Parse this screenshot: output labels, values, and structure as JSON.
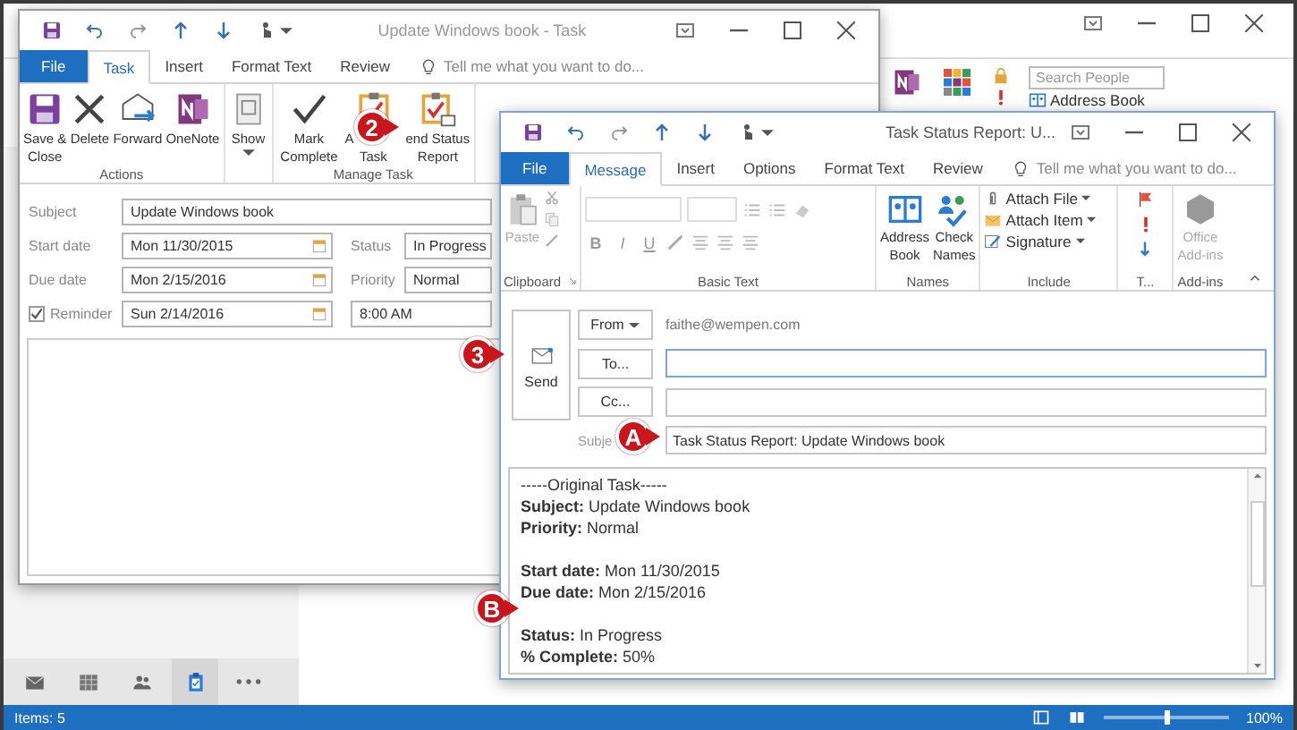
{
  "main_window": {
    "search_people": {
      "placeholder": "Search People"
    },
    "address_book": "Address Book",
    "nav": [
      {
        "kind": "mail",
        "selected": false
      },
      {
        "kind": "calendar",
        "selected": false
      },
      {
        "kind": "people",
        "selected": false
      },
      {
        "kind": "tasks",
        "selected": true
      },
      {
        "kind": "more",
        "selected": false
      }
    ],
    "status_bar": {
      "items": "Items: 5",
      "zoom": "100%",
      "zoom_slider": {
        "level": 0.5
      }
    }
  },
  "task_window": {
    "title": "Update Windows book - Task",
    "tell_me": "Tell me what you want to do...",
    "tabs": [
      {
        "label": "File",
        "kind": "file",
        "selected": false
      },
      {
        "label": "Task",
        "kind": "tab",
        "selected": true
      },
      {
        "label": "Insert",
        "kind": "tab",
        "selected": false
      },
      {
        "label": "Format Text",
        "kind": "tab",
        "selected": false
      },
      {
        "label": "Review",
        "kind": "tab",
        "selected": false
      }
    ],
    "ribbon_groups": [
      {
        "label": "Actions",
        "buttons": [
          {
            "kind": "save",
            "lines": [
              "Save &",
              "Close"
            ]
          },
          {
            "kind": "delete",
            "lines": [
              "Delete"
            ]
          },
          {
            "kind": "forward",
            "lines": [
              "Forward"
            ]
          },
          {
            "kind": "onenote",
            "lines": [
              "OneNote"
            ]
          }
        ]
      },
      {
        "buttons": [
          {
            "kind": "show",
            "lines": [
              "Show"
            ],
            "dropdown": true
          }
        ]
      },
      {
        "label": "Manage Task",
        "buttons": [
          {
            "kind": "check",
            "lines": [
              "Mark",
              "Complete"
            ]
          },
          {
            "kind": "assign",
            "lines": [
              "A",
              "Task"
            ]
          },
          {
            "kind": "report",
            "lines": [
              "end Status",
              "Report"
            ]
          }
        ]
      }
    ],
    "form": {
      "subject": {
        "label": "Subject",
        "value": "Update Windows book"
      },
      "start_date": {
        "label": "Start date",
        "value": "Mon 11/30/2015"
      },
      "status": {
        "label": "Status",
        "value": "In Progress"
      },
      "due_date": {
        "label": "Due date",
        "value": "Mon 2/15/2016"
      },
      "priority": {
        "label": "Priority",
        "value": "Normal"
      },
      "reminder": {
        "label": "Reminder",
        "checked": true,
        "date": "Sun 2/14/2016",
        "time": "8:00 AM"
      }
    }
  },
  "message_window": {
    "title": "Task Status Report: U...",
    "tell_me": "Tell me what you want to do...",
    "tabs": [
      {
        "label": "File",
        "kind": "file",
        "selected": false
      },
      {
        "label": "Message",
        "kind": "tab",
        "selected": true
      },
      {
        "label": "Insert",
        "kind": "tab",
        "selected": false
      },
      {
        "label": "Options",
        "kind": "tab",
        "selected": false
      },
      {
        "label": "Format Text",
        "kind": "tab",
        "selected": false
      },
      {
        "label": "Review",
        "kind": "tab",
        "selected": false
      }
    ],
    "ribbon": {
      "clipboard": {
        "label": "Clipboard",
        "paste": "Paste"
      },
      "basic_text": {
        "label": "Basic Text",
        "format_buttons": [
          "B",
          "I",
          "U"
        ]
      },
      "names": {
        "label": "Names",
        "buttons": [
          {
            "kind": "address-book",
            "lines": [
              "Address",
              "Book"
            ]
          },
          {
            "kind": "check-names",
            "lines": [
              "Check",
              "Names"
            ]
          }
        ]
      },
      "include": {
        "label": "Include",
        "items": [
          {
            "kind": "attach-file",
            "label": "Attach File"
          },
          {
            "kind": "attach-item",
            "label": "Attach Item"
          },
          {
            "kind": "signature",
            "label": "Signature"
          }
        ]
      },
      "tags": {
        "label": "T..."
      },
      "addins": {
        "label": "Add-ins",
        "button": {
          "lines": [
            "Office",
            "Add-ins"
          ],
          "disabled": true
        }
      }
    },
    "compose": {
      "send": "Send",
      "from": "From",
      "from_address": "faithe@wempen.com",
      "to": "To...",
      "cc": "Cc...",
      "subject_label": "Subje",
      "subject": "Task Status Report: Update Windows book"
    },
    "body": [
      {
        "lines": [
          "-----Original Task-----",
          "**Subject:** Update Windows book",
          "**Priority:** Normal"
        ]
      },
      {
        "lines": [
          "**Start date:** Mon 11/30/2015",
          "**Due date:** Mon 2/15/2016"
        ]
      },
      {
        "lines": [
          "**Status:** In Progress",
          "**% Complete:** 50%"
        ]
      }
    ]
  },
  "callouts": [
    {
      "label": "2"
    },
    {
      "label": "3"
    },
    {
      "label": "A"
    },
    {
      "label": "B"
    }
  ]
}
